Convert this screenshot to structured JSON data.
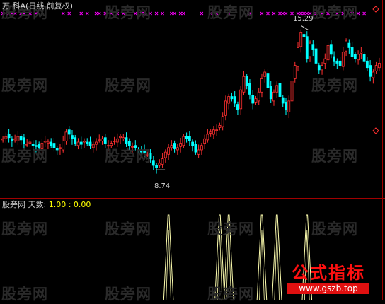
{
  "header": {
    "title": "万 科A(日线 前复权)",
    "indicator_name": "股旁网 天数:",
    "indicator_values": "1.00 : 0.00"
  },
  "watermark": "股旁网",
  "brand": {
    "name": "公式指标",
    "url": "www.gszb.top"
  },
  "colors": {
    "up": "#ff3030",
    "down": "#00ffff",
    "marker": "#ff00ff",
    "spike": "#ffffb0",
    "axis": "#a00000"
  },
  "annotations": {
    "high": "15.29",
    "low": "8.74"
  },
  "chart_data": {
    "type": "candlestick",
    "price_range": [
      7.6,
      16.0
    ],
    "high_label": 15.29,
    "low_label": 8.74,
    "closes": [
      10.2,
      10.3,
      10.25,
      10.1,
      10.2,
      10.3,
      10.15,
      10.0,
      9.95,
      10.05,
      9.9,
      9.85,
      9.8,
      10.0,
      10.1,
      10.05,
      9.9,
      9.8,
      9.7,
      9.8,
      10.1,
      10.5,
      10.4,
      10.2,
      10.0,
      10.05,
      9.95,
      10.1,
      10.0,
      9.9,
      9.95,
      10.05,
      10.15,
      10.2,
      10.0,
      9.9,
      10.0,
      10.1,
      10.2,
      10.3,
      10.25,
      10.0,
      9.9,
      9.85,
      9.8,
      9.7,
      9.6,
      9.55,
      9.5,
      9.3,
      9.0,
      8.9,
      9.1,
      9.3,
      9.6,
      9.8,
      9.9,
      9.75,
      9.8,
      10.0,
      10.3,
      10.2,
      10.1,
      9.9,
      9.6,
      9.7,
      9.9,
      10.2,
      10.4,
      10.5,
      10.6,
      10.6,
      10.8,
      11.2,
      11.9,
      12.1,
      12.0,
      11.8,
      11.5,
      12.4,
      13.0,
      12.6,
      12.2,
      11.8,
      12.0,
      12.3,
      12.9,
      13.2,
      12.5,
      12.0,
      12.3,
      12.6,
      12.1,
      11.8,
      11.5,
      11.9,
      12.8,
      13.5,
      14.3,
      15.0,
      14.8,
      13.8,
      14.5,
      14.2,
      13.6,
      13.3,
      13.5,
      13.8,
      14.4,
      14.0,
      13.7,
      13.6,
      13.5,
      14.1,
      14.6,
      14.3,
      13.9,
      13.8,
      14.0,
      14.1,
      13.7,
      13.4,
      13.0,
      13.2,
      13.5,
      13.6
    ],
    "marker_indices": [
      0,
      2,
      3,
      4,
      6,
      7,
      9,
      11,
      20,
      22,
      26,
      28,
      31,
      32,
      34,
      36,
      38,
      40,
      44,
      46,
      47,
      49,
      51,
      53,
      56,
      57,
      59,
      60,
      66,
      69,
      71,
      75,
      82,
      86,
      88,
      90,
      92,
      93,
      94,
      96,
      98,
      99,
      100,
      101,
      102,
      104,
      106,
      108,
      111,
      113,
      116,
      118,
      120
    ],
    "spike_indices": [
      55,
      72,
      75,
      86,
      91,
      101
    ],
    "spike_max": 1.0
  }
}
